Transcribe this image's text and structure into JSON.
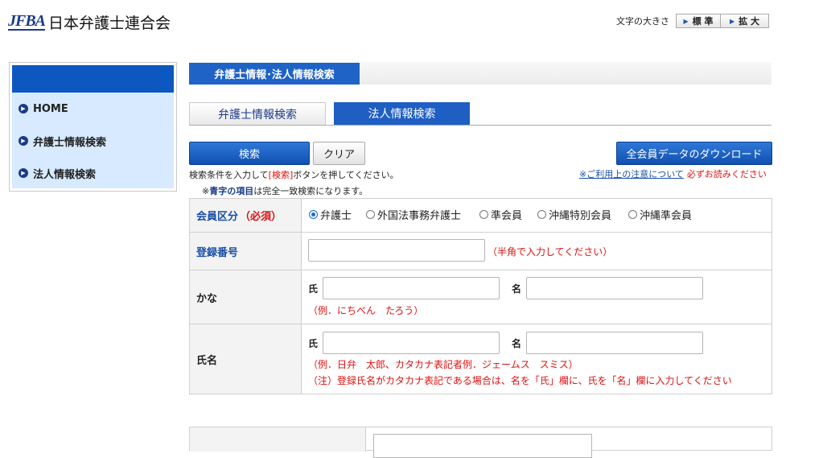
{
  "header": {
    "logo_mark": "JFBA",
    "logo_text": "日本弁護士連合会",
    "font_size_label": "文字の大きさ",
    "font_size_buttons": [
      "標 準",
      "拡 大"
    ]
  },
  "sidebar": {
    "items": [
      {
        "label": "HOME"
      },
      {
        "label": "弁護士情報検索"
      },
      {
        "label": "法人情報検索"
      }
    ]
  },
  "section_title": "弁護士情報･法人情報検索",
  "tabs": [
    {
      "label": "弁護士情報検索",
      "active": false
    },
    {
      "label": "法人情報検索",
      "active": true
    }
  ],
  "buttons": {
    "search": "検索",
    "clear": "クリア",
    "download": "全会員データのダウンロード"
  },
  "hints": {
    "line1_pre": "検索条件を入力して",
    "line1_red": "[検索]",
    "line1_post": "ボタンを押してください。",
    "line2_mark": "※",
    "line2_blue": "青字の項目",
    "line2_post": "は完全一致検索になります。",
    "notice_link": "※ご利用上の注意について",
    "notice_red": "必ずお読みください"
  },
  "form": {
    "member_type": {
      "label": "会員区分",
      "required": "（必須）",
      "options": [
        "弁護士",
        "外国法事務弁護士",
        "準会員",
        "沖縄特別会員",
        "沖縄準会員"
      ],
      "selected": "弁護士"
    },
    "reg_number": {
      "label": "登録番号",
      "value": "",
      "note": "（半角で入力してください）"
    },
    "kana": {
      "label": "かな",
      "sei": "氏",
      "mei": "名",
      "sei_value": "",
      "mei_value": "",
      "example": "（例．にちべん　たろう）"
    },
    "name": {
      "label": "氏名",
      "sei": "氏",
      "mei": "名",
      "sei_value": "",
      "mei_value": "",
      "example": "（例．日弁　太郎、カタカナ表記者例．ジェームス　スミス）",
      "caution": "（注）登録氏名がカタカナ表記である場合は、名を「氏」欄に、氏を「名」欄に入力してください"
    }
  },
  "colors": {
    "brand_blue": "#1f63c6",
    "sidebar_bg": "#d7eaff",
    "required_red": "#dd1111"
  }
}
